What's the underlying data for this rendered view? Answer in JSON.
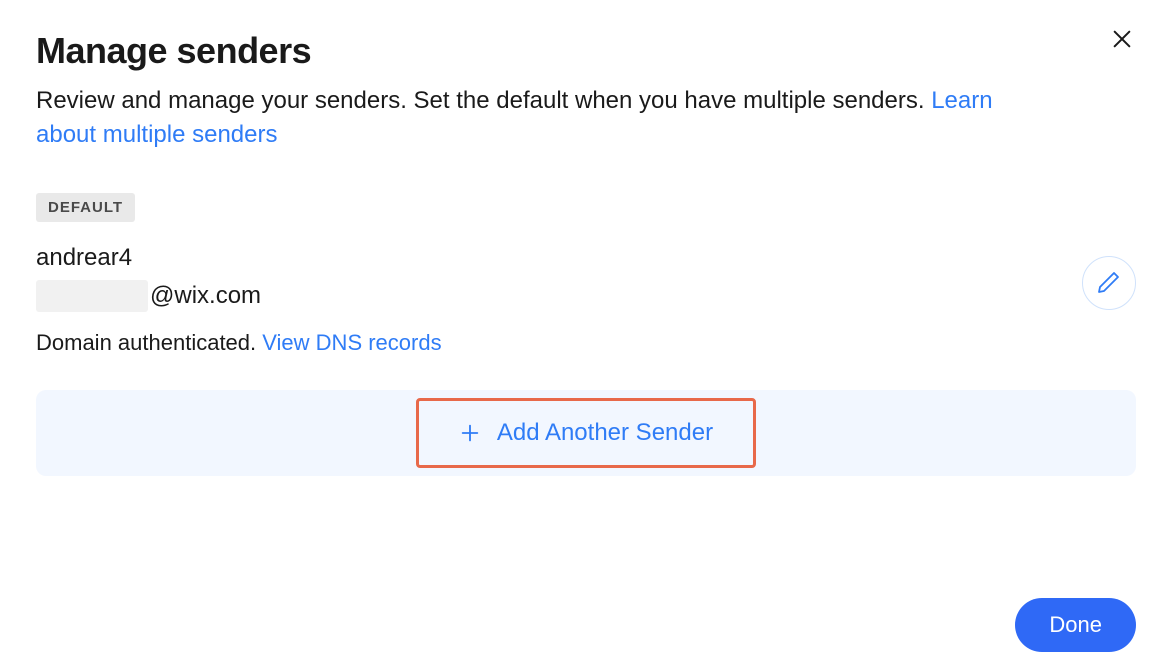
{
  "dialog": {
    "title": "Manage senders",
    "subtitle_text": "Review and manage your senders. Set the default when you have multiple senders. ",
    "subtitle_link": "Learn about multiple senders"
  },
  "default_badge": "DEFAULT",
  "sender": {
    "name": "andrear4",
    "email_suffix": "@wix.com",
    "status_text": "Domain authenticated. ",
    "status_link": "View DNS records"
  },
  "actions": {
    "add_sender": "Add Another Sender",
    "done": "Done"
  }
}
